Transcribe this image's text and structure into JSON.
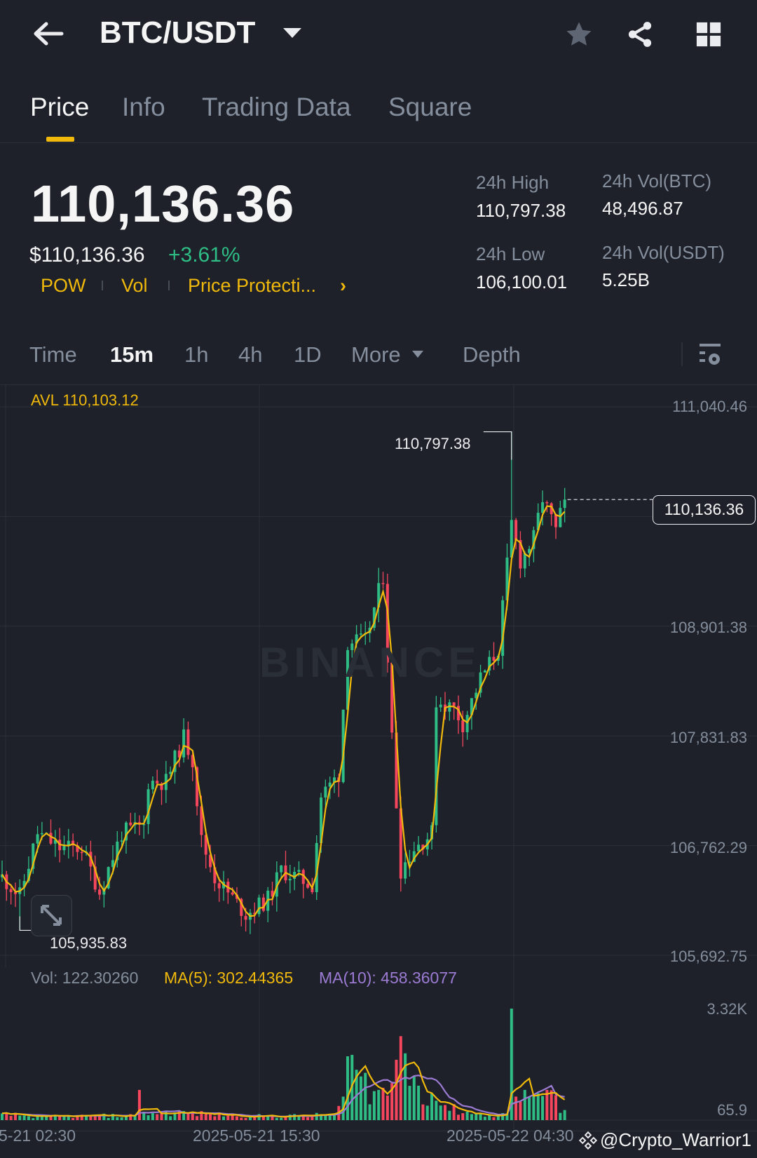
{
  "header": {
    "title": "BTC/USDT",
    "back_icon": "arrow-left-icon",
    "icons": [
      "star-icon",
      "share-icon",
      "grid-icon"
    ]
  },
  "tabs": [
    {
      "label": "Price",
      "active": true
    },
    {
      "label": "Info"
    },
    {
      "label": "Trading Data"
    },
    {
      "label": "Square"
    }
  ],
  "ticker": {
    "last_price": "110,136.36",
    "usd_price": "$110,136.36",
    "change": "+3.61%",
    "tags": [
      "POW",
      "Vol",
      "Price Protecti..."
    ],
    "high_label": "24h High",
    "high": "110,797.38",
    "low_label": "24h Low",
    "low": "106,100.01",
    "vol_btc_label": "24h Vol(BTC)",
    "vol_btc": "48,496.87",
    "vol_usdt_label": "24h Vol(USDT)",
    "vol_usdt": "5.25B"
  },
  "intervals": [
    {
      "label": "Time"
    },
    {
      "label": "15m",
      "active": true
    },
    {
      "label": "1h"
    },
    {
      "label": "4h"
    },
    {
      "label": "1D"
    },
    {
      "label": "More"
    },
    {
      "label": "Depth"
    }
  ],
  "colors": {
    "up": "#2ebd85",
    "down": "#f6465d",
    "accent": "#f0b90b",
    "ma10": "#9c7bd4"
  },
  "chart_data": {
    "type": "candlestick",
    "avl": "AVL 110,103.12",
    "y_ticks": [
      "111,040.46",
      "108,901.38",
      "107,831.83",
      "106,762.29",
      "105,692.75"
    ],
    "y_tick_values": [
      111040.46,
      108901.38,
      107831.83,
      106762.29,
      105692.75
    ],
    "ylim": [
      105692.75,
      111040.46
    ],
    "high_annotation": "110,797.38",
    "high_value": 110797.38,
    "high_index": 115,
    "low_annotation": "105,935.83",
    "low_value": 105935.83,
    "low_index": 4,
    "current_price": "110,136.36",
    "current_value": 110136.36,
    "x_ticks": [
      "5-21 02:30",
      "2025-05-21 15:30",
      "2025-05-22 04:30"
    ],
    "candle_count": 128,
    "close_keypoints": [
      [
        0,
        106454
      ],
      [
        4,
        106274
      ],
      [
        8,
        106884
      ],
      [
        13,
        106740
      ],
      [
        18,
        106740
      ],
      [
        22,
        106310
      ],
      [
        27,
        106884
      ],
      [
        32,
        106956
      ],
      [
        33,
        107387
      ],
      [
        37,
        107387
      ],
      [
        41,
        107818
      ],
      [
        43,
        107600
      ],
      [
        45,
        106812
      ],
      [
        48,
        106454
      ],
      [
        55,
        106095
      ],
      [
        60,
        106238
      ],
      [
        63,
        106525
      ],
      [
        70,
        106380
      ],
      [
        72,
        107243
      ],
      [
        76,
        107459
      ],
      [
        78,
        108751
      ],
      [
        82,
        108751
      ],
      [
        86,
        109394
      ],
      [
        88,
        107818
      ],
      [
        90,
        106530
      ],
      [
        93,
        106740
      ],
      [
        97,
        106884
      ],
      [
        98,
        108177
      ],
      [
        102,
        108100
      ],
      [
        104,
        107950
      ],
      [
        108,
        108392
      ],
      [
        112,
        108679
      ],
      [
        115,
        109900
      ],
      [
        117,
        109540
      ],
      [
        120,
        109756
      ],
      [
        122,
        110150
      ],
      [
        125,
        109830
      ],
      [
        127,
        110136
      ]
    ],
    "volume": {
      "label": "Vol: 122.30260",
      "ma5": "MA(5): 302.44365",
      "ma10": "MA(10): 458.36077",
      "y_ticks": [
        "3.32K",
        "65.9"
      ],
      "max": 3320,
      "keypoints": [
        [
          0,
          200
        ],
        [
          10,
          110
        ],
        [
          20,
          150
        ],
        [
          30,
          150
        ],
        [
          31,
          900
        ],
        [
          32,
          250
        ],
        [
          40,
          250
        ],
        [
          47,
          200
        ],
        [
          60,
          130
        ],
        [
          70,
          160
        ],
        [
          75,
          200
        ],
        [
          77,
          700
        ],
        [
          78,
          1900
        ],
        [
          80,
          1500
        ],
        [
          85,
          900
        ],
        [
          88,
          1100
        ],
        [
          90,
          2500
        ],
        [
          93,
          1300
        ],
        [
          97,
          800
        ],
        [
          100,
          450
        ],
        [
          105,
          250
        ],
        [
          110,
          150
        ],
        [
          114,
          200
        ],
        [
          115,
          3320
        ],
        [
          116,
          700
        ],
        [
          118,
          900
        ],
        [
          121,
          800
        ],
        [
          123,
          900
        ],
        [
          127,
          300
        ]
      ]
    }
  },
  "watermark": {
    "text": "@Crypto_Warrior1",
    "logo": "BINANCE"
  }
}
